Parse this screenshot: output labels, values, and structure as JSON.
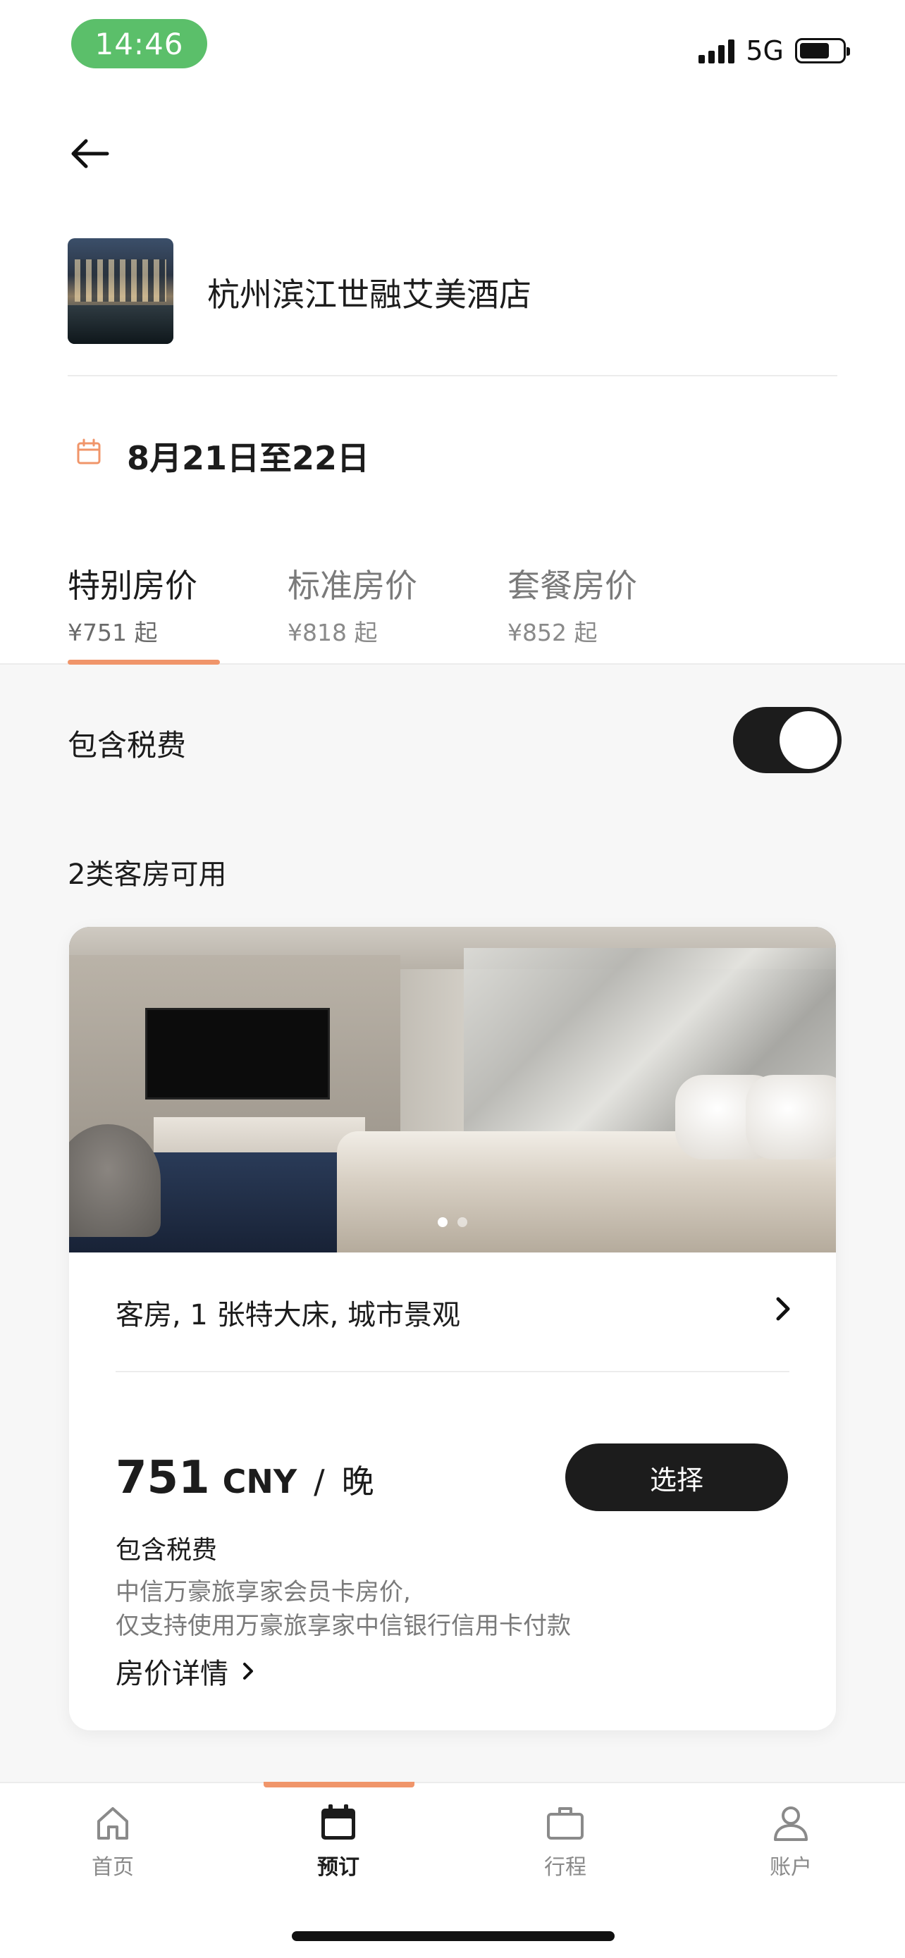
{
  "status_bar": {
    "time": "14:46",
    "network": "5G",
    "time_pill_color": "#5bbf6a"
  },
  "header": {
    "back_icon": "arrow-left-icon"
  },
  "hotel": {
    "name": "杭州滨江世融艾美酒店"
  },
  "dates": {
    "text": "8月21日至22日",
    "icon": "calendar-icon"
  },
  "tabs": [
    {
      "label": "特别房价",
      "price": "¥751 起",
      "active": true
    },
    {
      "label": "标准房价",
      "price": "¥818 起",
      "active": false
    },
    {
      "label": "套餐房价",
      "price": "¥852 起",
      "active": false
    }
  ],
  "tax_toggle": {
    "label": "包含税费",
    "on": true
  },
  "rooms_available": "2类客房可用",
  "room_card": {
    "photo_dots": 2,
    "current_photo": 1,
    "name": "客房, 1 张特大床, 城市景观",
    "price": "751",
    "currency": "CNY",
    "separator": "/",
    "per": "晚",
    "select_label": "选择",
    "tax_note": "包含税费",
    "note_line1": "中信万豪旅享家会员卡房价,",
    "note_line2": "仅支持使用万豪旅享家中信银行信用卡付款",
    "detail_link": "房价详情"
  },
  "bottom_nav": [
    {
      "label": "首页",
      "icon": "home-icon",
      "active": false
    },
    {
      "label": "预订",
      "icon": "calendar-icon",
      "active": true
    },
    {
      "label": "行程",
      "icon": "briefcase-icon",
      "active": false
    },
    {
      "label": "账户",
      "icon": "user-icon",
      "active": false
    }
  ],
  "colors": {
    "accent": "#f0956a",
    "primary": "#1c1c1c",
    "muted": "#7a7a7a"
  }
}
